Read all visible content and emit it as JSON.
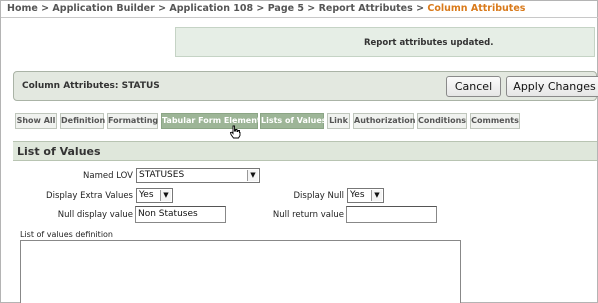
{
  "breadcrumb": {
    "items": [
      "Home",
      "Application Builder",
      "Application 108",
      "Page 5",
      "Report Attributes"
    ],
    "separator": ">",
    "current": "Column Attributes"
  },
  "message": "Report attributes updated.",
  "column_attributes": {
    "title": "Column Attributes: STATUS",
    "cancel_label": "Cancel",
    "apply_label": "Apply Changes"
  },
  "tabs": [
    {
      "label": "Show All",
      "active": false
    },
    {
      "label": "Definition",
      "active": false
    },
    {
      "label": "Formatting",
      "active": false
    },
    {
      "label": "Tabular Form Element",
      "active": true
    },
    {
      "label": "Lists of Values",
      "active": true
    },
    {
      "label": "Link",
      "active": false
    },
    {
      "label": "Authorization",
      "active": false
    },
    {
      "label": "Conditions",
      "active": false
    },
    {
      "label": "Comments",
      "active": false
    }
  ],
  "lov_section": {
    "title": "List of Values",
    "named_lov_label": "Named LOV",
    "named_lov_value": "STATUSES",
    "display_extra_label": "Display Extra Values",
    "display_extra_value": "Yes",
    "display_null_label": "Display Null",
    "display_null_value": "Yes",
    "null_display_label": "Null display value",
    "null_display_value": "Non Statuses",
    "null_return_label": "Null return value",
    "null_return_value": "",
    "lov_definition_label": "List of values definition",
    "lov_definition_value": ""
  },
  "colors": {
    "breadcrumb_current": "#d97a1b",
    "active_tab": "#9db597",
    "section_header": "#dfe7db",
    "message_bar": "#e6eee6"
  },
  "icons": {
    "cursor": "hand-pointer-icon",
    "dropdown": "chevron-down-icon"
  }
}
